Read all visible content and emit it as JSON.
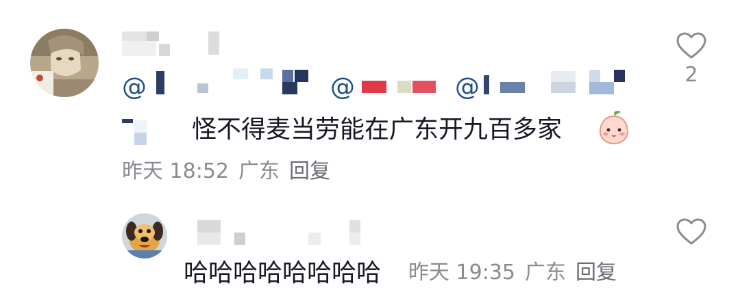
{
  "comment": {
    "mentions": [
      "@",
      "@",
      "@"
    ],
    "text": "怪不得麦当劳能在广东开九百多家",
    "emoji": "peach-face-emoji",
    "time": "昨天 18:52",
    "location": "广东",
    "reply_label": "回复",
    "like_count": "2"
  },
  "reply": {
    "text": "哈哈哈哈哈哈哈哈",
    "time": "昨天 19:35",
    "location": "广东",
    "reply_label": "回复"
  },
  "colors": {
    "mention": "#1f4e8c",
    "text": "#161823",
    "meta": "#8a8b91"
  }
}
